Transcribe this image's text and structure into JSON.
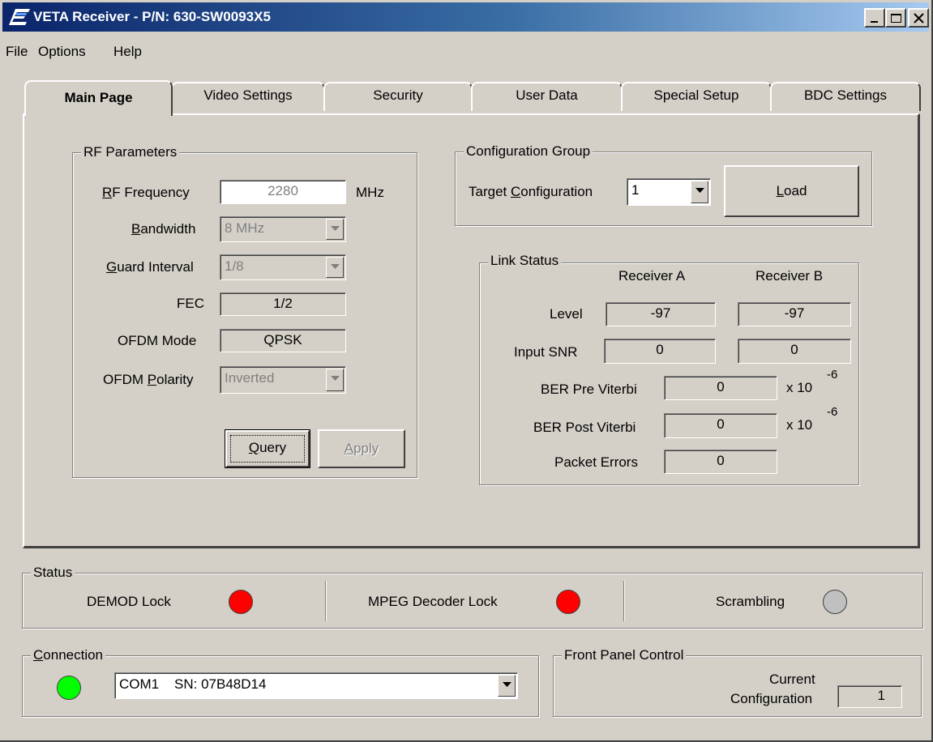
{
  "window": {
    "title": "VETA Receiver - P/N:  630-SW0093X5",
    "controls": [
      "minimize-icon",
      "maximize-icon",
      "close-icon"
    ]
  },
  "menu": [
    {
      "label": "File"
    },
    {
      "label": "Options"
    },
    {
      "label": "Help"
    }
  ],
  "tabs": [
    {
      "label": "Main Page",
      "active": true
    },
    {
      "label": "Video Settings"
    },
    {
      "label": "Security"
    },
    {
      "label": "User Data"
    },
    {
      "label": "Special Setup"
    },
    {
      "label": "BDC Settings"
    }
  ],
  "rf_parameters": {
    "title": "RF Parameters",
    "rf_frequency": {
      "label_mnemonic": "R",
      "label_rest": "F Frequency",
      "value": "2280",
      "unit": "MHz"
    },
    "bandwidth": {
      "label_mnemonic": "B",
      "label_rest": "andwidth",
      "value": "8 MHz"
    },
    "guard_interval": {
      "label_mnemonic": "G",
      "label_rest": "uard Interval",
      "value": "1/8"
    },
    "fec": {
      "label": "FEC",
      "value": "1/2"
    },
    "ofdm_mode": {
      "label": "OFDM Mode",
      "value": "QPSK"
    },
    "ofdm_polarity": {
      "label_pre": "OFDM ",
      "label_mnemonic": "P",
      "label_rest": "olarity",
      "value": "Inverted"
    },
    "query_button": {
      "mnemonic": "Q",
      "rest": "uery"
    },
    "apply_button": {
      "mnemonic": "A",
      "rest": "pply"
    }
  },
  "configuration_group": {
    "title": "Configuration Group",
    "target_label_pre": "Target ",
    "target_label_mnemonic": "C",
    "target_label_rest": "onfiguration",
    "target_value": "1",
    "load_button": {
      "mnemonic": "L",
      "rest": "oad"
    }
  },
  "link_status": {
    "title": "Link Status",
    "col_a": "Receiver A",
    "col_b": "Receiver B",
    "level": {
      "label": "Level",
      "a": "-97",
      "b": "-97"
    },
    "input_snr": {
      "label": "Input SNR",
      "a": "0",
      "b": "0"
    },
    "ber_pre": {
      "label": "BER Pre Viterbi",
      "value": "0",
      "unit": "x 10",
      "exp": "-6"
    },
    "ber_post": {
      "label": "BER Post Viterbi",
      "value": "0",
      "unit": "x 10",
      "exp": "-6"
    },
    "packet_errors": {
      "label": "Packet Errors",
      "value": "0"
    }
  },
  "status": {
    "title": "Status",
    "demod": {
      "label": "DEMOD Lock",
      "color": "#ff0000"
    },
    "mpeg": {
      "label": "MPEG Decoder Lock",
      "color": "#ff0000"
    },
    "scrambling": {
      "label": "Scrambling",
      "color": "#c0c0c0"
    }
  },
  "connection": {
    "title_mnemonic": "C",
    "title_rest": "onnection",
    "led_color": "#00ff00",
    "port": "COM1    SN: 07B48D14"
  },
  "front_panel": {
    "title": "Front Panel Control",
    "label_line1": "Current",
    "label_line2": "Configuration",
    "value": "1"
  }
}
